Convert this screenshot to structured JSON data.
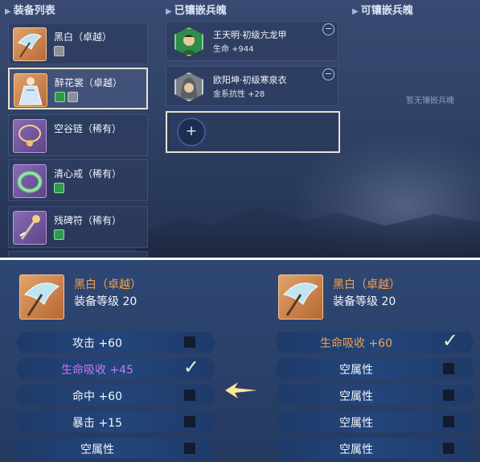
{
  "top": {
    "headers": {
      "equipment_list": "装备列表",
      "inlaid": "已镶嵌兵魄",
      "available": "可镶嵌兵魄"
    },
    "equipment": [
      {
        "name": "黑白（卓越）",
        "icon": "parasol-icon",
        "frame": "orange",
        "gems": [
          "grey"
        ]
      },
      {
        "name": "醉花裳（卓越）",
        "icon": "dress-icon",
        "frame": "orange",
        "gems": [
          "green",
          "grey"
        ],
        "selected": true
      },
      {
        "name": "空谷链（稀有）",
        "icon": "necklace-icon",
        "frame": "purple",
        "gems": []
      },
      {
        "name": "清心戒（稀有）",
        "icon": "ring-icon",
        "frame": "purple",
        "gems": [
          "green"
        ]
      },
      {
        "name": "残碑符（稀有）",
        "icon": "talisman-icon",
        "frame": "purple",
        "gems": [
          "green"
        ]
      }
    ],
    "inlaid": [
      {
        "name": "王天明·初级亢龙甲",
        "stat": "生命 +944",
        "frame": "green",
        "icon": "warrior-portrait-icon"
      },
      {
        "name": "欧阳坤·初级寒泉衣",
        "stat": "金系抗性 +28",
        "frame": "grey",
        "icon": "hooded-portrait-icon"
      }
    ],
    "available_empty_text": "暂无镶嵌兵魄",
    "add_symbol": "+",
    "remove_symbol": "−"
  },
  "bottom": {
    "left": {
      "name": "黑白（卓越）",
      "level": "装备等级 20",
      "attrs": [
        {
          "text": "攻击 +60",
          "color": "#f2f5fb",
          "checked": false
        },
        {
          "text": "生命吸收 +45",
          "color": "#c27cf0",
          "checked": true
        },
        {
          "text": "命中 +60",
          "color": "#f2f5fb",
          "checked": false
        },
        {
          "text": "暴击 +15",
          "color": "#f2f5fb",
          "checked": false
        },
        {
          "text": "空属性",
          "color": "#f2f5fb",
          "checked": false
        }
      ]
    },
    "right": {
      "name": "黑白（卓越）",
      "level": "装备等级 20",
      "attrs": [
        {
          "text": "生命吸收 +60",
          "color": "#f3a24a",
          "checked": true
        },
        {
          "text": "空属性",
          "color": "#f2f5fb",
          "checked": false
        },
        {
          "text": "空属性",
          "color": "#f2f5fb",
          "checked": false
        },
        {
          "text": "空属性",
          "color": "#f2f5fb",
          "checked": false
        },
        {
          "text": "空属性",
          "color": "#f2f5fb",
          "checked": false
        }
      ]
    },
    "exchange_icon": "left-arrow-icon",
    "check_symbol": "✓"
  }
}
